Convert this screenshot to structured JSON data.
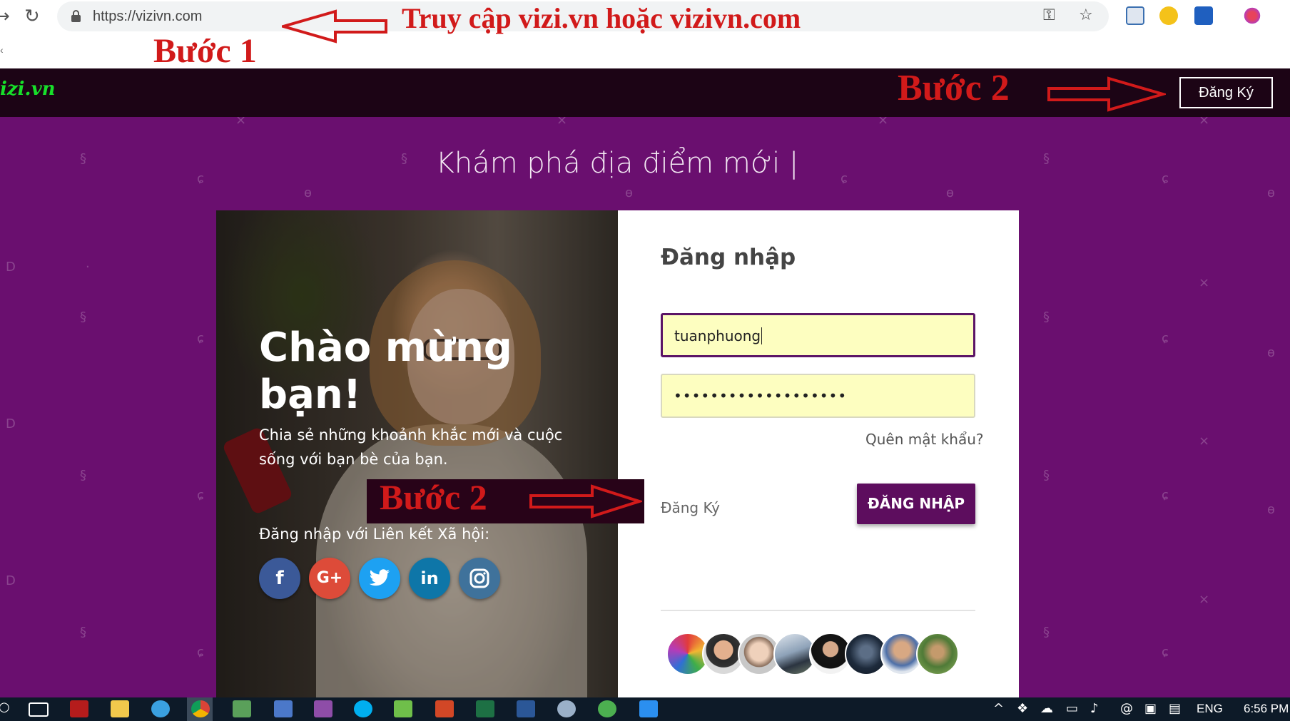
{
  "browser": {
    "url": "https://vizivn.com",
    "back_icon": "arrow-left-icon",
    "reload_icon": "reload-icon",
    "key_icon": "key-icon",
    "star_icon": "star-icon"
  },
  "annotations": {
    "access_instruction": "Truy cập vizi.vn hoặc vizivn.com",
    "step1": "Bước 1",
    "step2_header": "Bước 2",
    "step2_form": "Bước 2"
  },
  "header": {
    "logo": "izi.vn",
    "register_button": "Đăng Ký"
  },
  "hero": {
    "tagline": "Khám phá địa điểm mới |"
  },
  "welcome": {
    "title": "Chào mừng bạn!",
    "subtitle": "Chia sẻ những khoảnh khắc mới và cuộc sống với bạn bè của bạn.",
    "social_label": "Đăng nhập với Liên kết Xã hội:",
    "social_icons": [
      "facebook-icon",
      "google-plus-icon",
      "twitter-icon",
      "linkedin-icon",
      "instagram-icon"
    ]
  },
  "login": {
    "title": "Đăng nhập",
    "username_value": "tuanphuong",
    "password_value": "•••••••••••••••••••",
    "forgot_password": "Quên mật khẩu?",
    "register_link": "Đăng Ký",
    "login_button": "ĐĂNG NHẬP"
  },
  "taskbar": {
    "language": "ENG",
    "clock": "6:56 PM"
  },
  "colors": {
    "hero_purple": "#6a0f6f",
    "header_dark": "#1c0415",
    "button_purple": "#5d0d5e",
    "annotation_red": "#d11a1a",
    "field_yellow": "#fdfec0"
  }
}
